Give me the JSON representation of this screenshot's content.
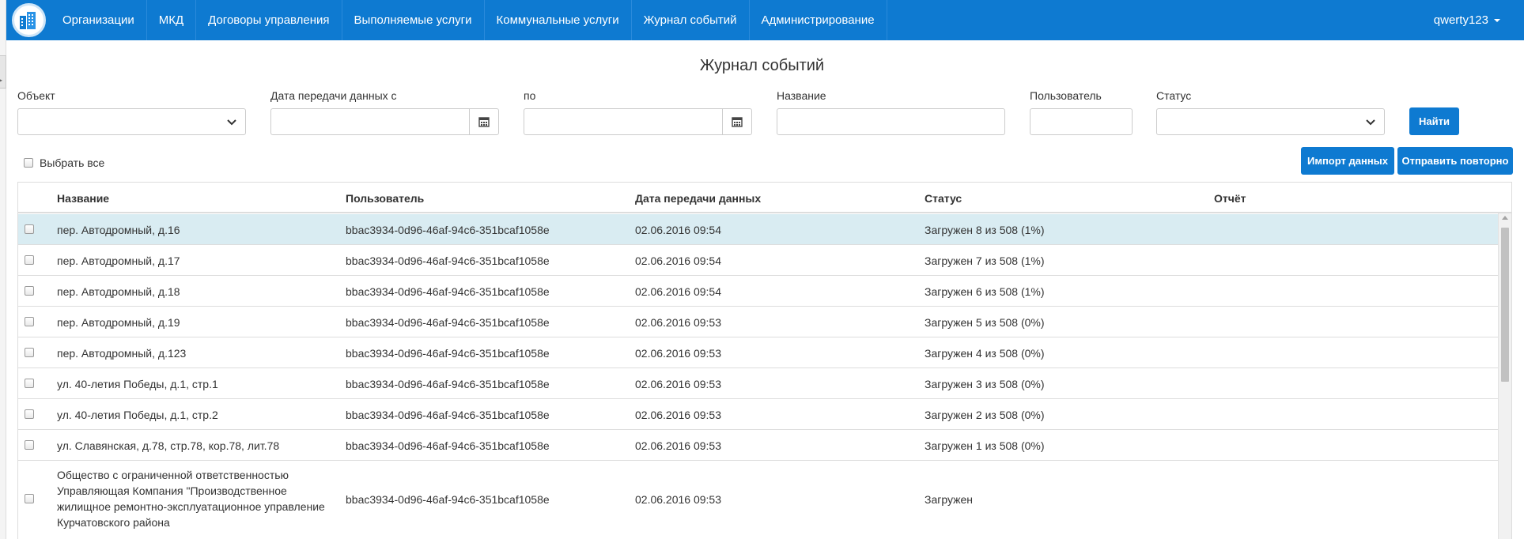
{
  "nav": {
    "items": [
      "Организации",
      "МКД",
      "Договоры управления",
      "Выполняемые услуги",
      "Коммунальные услуги",
      "Журнал событий",
      "Администрирование"
    ],
    "user": "qwerty123"
  },
  "page": {
    "title": "Журнал событий"
  },
  "filters": {
    "object_label": "Объект",
    "object_value": "",
    "date_from_label": "Дата передачи данных с",
    "date_from_value": "",
    "date_to_label": "по",
    "date_to_value": "",
    "name_label": "Название",
    "name_value": "",
    "user_label": "Пользователь",
    "user_value": "",
    "status_label": "Статус",
    "status_value": "",
    "find_button": "Найти"
  },
  "actions": {
    "select_all_label": "Выбрать все",
    "import_button": "Импорт данных",
    "resend_button": "Отправить повторно"
  },
  "table": {
    "columns": {
      "name": "Название",
      "user": "Пользователь",
      "date": "Дата передачи данных",
      "status": "Статус",
      "report": "Отчёт"
    },
    "rows": [
      {
        "name": "пер. Автодромный, д.16",
        "user": "bbac3934-0d96-46af-94c6-351bcaf1058e",
        "date": "02.06.2016 09:54",
        "status": "Загружен 8 из 508 (1%)",
        "report": ""
      },
      {
        "name": "пер. Автодромный, д.17",
        "user": "bbac3934-0d96-46af-94c6-351bcaf1058e",
        "date": "02.06.2016 09:54",
        "status": "Загружен 7 из 508 (1%)",
        "report": ""
      },
      {
        "name": "пер. Автодромный, д.18",
        "user": "bbac3934-0d96-46af-94c6-351bcaf1058e",
        "date": "02.06.2016 09:54",
        "status": "Загружен 6 из 508 (1%)",
        "report": ""
      },
      {
        "name": "пер. Автодромный, д.19",
        "user": "bbac3934-0d96-46af-94c6-351bcaf1058e",
        "date": "02.06.2016 09:53",
        "status": "Загружен 5 из 508 (0%)",
        "report": ""
      },
      {
        "name": "пер. Автодромный, д.123",
        "user": "bbac3934-0d96-46af-94c6-351bcaf1058e",
        "date": "02.06.2016 09:53",
        "status": "Загружен 4 из 508 (0%)",
        "report": ""
      },
      {
        "name": "ул. 40-летия Победы, д.1, стр.1",
        "user": "bbac3934-0d96-46af-94c6-351bcaf1058e",
        "date": "02.06.2016 09:53",
        "status": "Загружен 3 из 508 (0%)",
        "report": ""
      },
      {
        "name": "ул. 40-летия Победы, д.1, стр.2",
        "user": "bbac3934-0d96-46af-94c6-351bcaf1058e",
        "date": "02.06.2016 09:53",
        "status": "Загружен 2 из 508 (0%)",
        "report": ""
      },
      {
        "name": "ул. Славянская, д.78, стр.78, кор.78, лит.78",
        "user": "bbac3934-0d96-46af-94c6-351bcaf1058e",
        "date": "02.06.2016 09:53",
        "status": "Загружен 1 из 508 (0%)",
        "report": ""
      },
      {
        "name": "Общество с ограниченной ответственностью Управляющая Компания \"Производственное жилищное ремонтно-эксплуатационное управление Курчатовского района",
        "user": "bbac3934-0d96-46af-94c6-351bcaf1058e",
        "date": "02.06.2016 09:53",
        "status": "Загружен",
        "report": ""
      }
    ]
  }
}
